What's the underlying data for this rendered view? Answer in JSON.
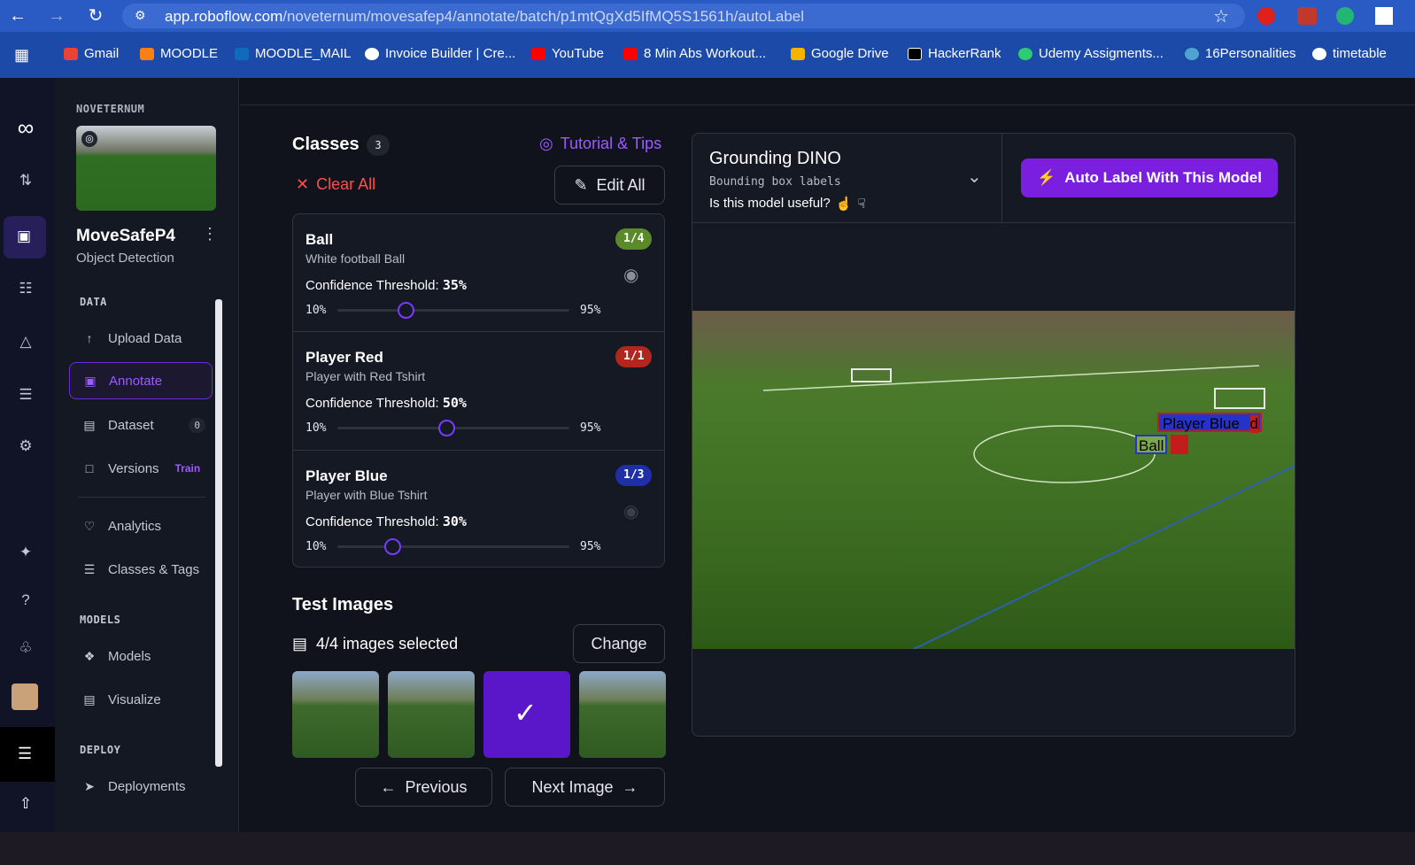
{
  "browser": {
    "url_domain": "app.roboflow.com",
    "url_path": "/noveternum/movesafep4/annotate/batch/p1mtQgXd5IfMQ5S1561h/autoLabel",
    "bookmarks": [
      "Gmail",
      "MOODLE",
      "MOODLE_MAIL",
      "Invoice Builder | Cre...",
      "YouTube",
      "8 Min Abs Workout...",
      "Google Drive",
      "HackerRank",
      "Udemy Assigments...",
      "16Personalities",
      "timetable"
    ]
  },
  "sidebar": {
    "workspace": "NOVETERNUM",
    "project_name": "MoveSafeP4",
    "project_type": "Object Detection",
    "section_data": "DATA",
    "upload": "Upload Data",
    "annotate": "Annotate",
    "dataset": "Dataset",
    "dataset_count": "0",
    "versions": "Versions",
    "versions_badge": "Train",
    "analytics": "Analytics",
    "classes_tags": "Classes & Tags",
    "section_models": "MODELS",
    "models": "Models",
    "visualize": "Visualize",
    "section_deploy": "DEPLOY",
    "deployments": "Deployments"
  },
  "classes_panel": {
    "title": "Classes",
    "count": "3",
    "tutorial": "Tutorial & Tips",
    "clear_all": "Clear All",
    "edit_all": "Edit All",
    "min_label": "10%",
    "max_label": "95%",
    "threshold_label": "Confidence Threshold: ",
    "classes": [
      {
        "name": "Ball",
        "desc": "White football Ball",
        "threshold": "35%",
        "threshold_value": 0.35,
        "ratio": "1/4",
        "badge_color": "#5a8a2a"
      },
      {
        "name": "Player Red",
        "desc": "Player with Red Tshirt",
        "threshold": "50%",
        "threshold_value": 0.5,
        "ratio": "1/1",
        "badge_color": "#b3261e"
      },
      {
        "name": "Player Blue",
        "desc": "Player with Blue Tshirt",
        "threshold": "30%",
        "threshold_value": 0.3,
        "ratio": "1/3",
        "badge_color": "#1f2fa8"
      }
    ]
  },
  "test_images": {
    "title": "Test Images",
    "selected": "4/4 images selected",
    "change": "Change",
    "previous": "Previous",
    "next": "Next Image"
  },
  "model_panel": {
    "name": "Grounding DINO",
    "subtitle": "Bounding box labels",
    "useful": "Is this model useful?",
    "auto_label": "Auto Label With This Model",
    "accent": "#7a1fe0"
  },
  "preview": {
    "labels": [
      "Player Blue",
      "d",
      "Ball"
    ]
  }
}
